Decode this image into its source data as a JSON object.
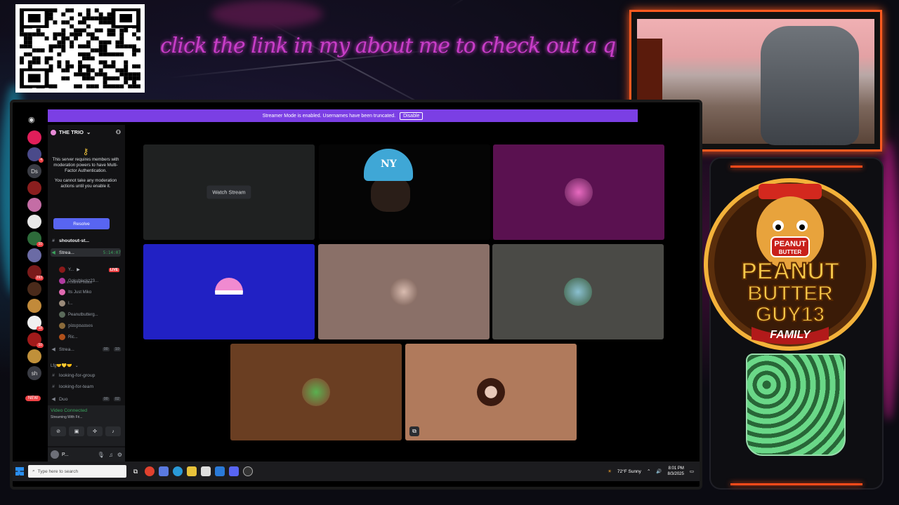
{
  "overlay": {
    "banner_text": "click the link in my about me to check out a quick an easy come up!",
    "logo": {
      "jar_label": "PEANUT",
      "jar_sublabel": "BUTTER",
      "line1": "PEANUT",
      "line2": "BUTTER",
      "line3": "GUY13",
      "line4": "FAMILY"
    }
  },
  "discord": {
    "streamer_mode": {
      "text": "Streamer Mode is enabled. Usernames have been truncated.",
      "disable_label": "Disable"
    },
    "servers": [
      "Ds",
      "sh"
    ],
    "server_badges": [
      "4",
      "10",
      "293",
      "18",
      "10"
    ],
    "new_badge": "NEW",
    "server_name": "THE TRIO",
    "mfa": {
      "line1": "This server requires members with moderation powers to have Multi-Factor Authentication.",
      "line2": "You cannot take any moderation actions until you enable it.",
      "resolve_label": "Resolve"
    },
    "channels": {
      "shoutout": "shoutout-st...",
      "stream_active": "Strea...",
      "stream_timer": "5:14:07",
      "channel_status": "Set a channel status",
      "members": [
        {
          "name": "Y...",
          "live": "LIVE"
        },
        {
          "name": "Gokublackz23..."
        },
        {
          "name": "Its Just Miko"
        },
        {
          "name": "I..."
        },
        {
          "name": "Peanutbutterg..."
        },
        {
          "name": "pimpnames"
        },
        {
          "name": "Ric..."
        }
      ],
      "stream2": "Strea...",
      "stream2_counts": [
        "00",
        "10"
      ],
      "category": "Lfg🤝💛🤝",
      "looking_group": "looking-for-group",
      "looking_team": "looking-for-team",
      "duo": "Duo",
      "duo_counts": [
        "00",
        "02"
      ]
    },
    "voice": {
      "status": "Video Connected",
      "sub": "Streaming With Fri..."
    },
    "user": {
      "name": "P..."
    },
    "stage": {
      "watch_label": "Watch Stream",
      "hat_text": "NY"
    }
  },
  "taskbar": {
    "search_placeholder": "Type here to search",
    "weather": "72°F  Sunny",
    "time": "8:01 PM",
    "date": "8/3/2025"
  },
  "colors": {
    "discord_accent": "#5865f2",
    "streamer_bar": "#7b3fe4",
    "webcam_border": "#ff5a1f",
    "tile_blue": "#2121c4",
    "tile_purple": "#5a1150"
  }
}
